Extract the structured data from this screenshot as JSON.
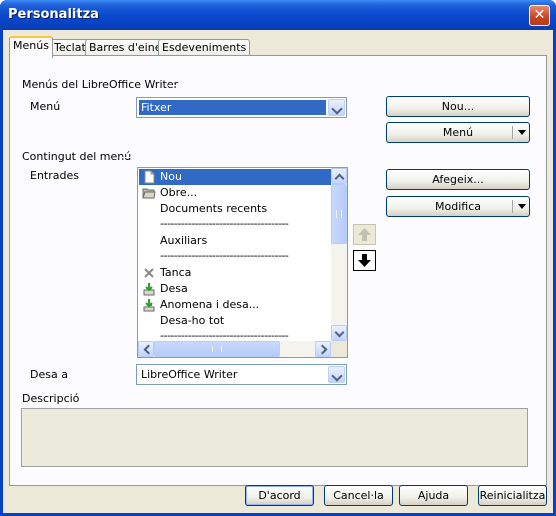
{
  "window": {
    "title": "Personalitza"
  },
  "tabs": [
    {
      "label": "Menús",
      "active": true
    },
    {
      "label": "Teclat",
      "active": false
    },
    {
      "label": "Barres d'eines",
      "active": false
    },
    {
      "label": "Esdeveniments",
      "active": false
    }
  ],
  "menus_section": {
    "heading": "Menús del LibreOffice Writer",
    "menu_label": "Menú",
    "menu_value": "Fitxer",
    "new_button": "Nou...",
    "menu_button": "Menú"
  },
  "content_section": {
    "heading": "Contingut del menú",
    "entries_label": "Entrades",
    "add_button": "Afegeix...",
    "modify_button": "Modifica",
    "entries": [
      {
        "label": "Nou",
        "icon": "new-document-icon",
        "selected": true
      },
      {
        "label": "Obre...",
        "icon": "open-folder-icon"
      },
      {
        "label": "Documents recents",
        "icon": ""
      },
      {
        "separator": true,
        "label": "-------------------------------------"
      },
      {
        "label": "Auxiliars",
        "icon": ""
      },
      {
        "separator": true,
        "label": "-------------------------------------"
      },
      {
        "label": "Tanca",
        "icon": "close-x-icon"
      },
      {
        "label": "Desa",
        "icon": "save-icon"
      },
      {
        "label": "Anomena i desa...",
        "icon": "save-as-icon"
      },
      {
        "label": "Desa-ho tot",
        "icon": ""
      },
      {
        "separator": true,
        "label": "-------------------------------------"
      }
    ]
  },
  "save_in": {
    "label": "Desa a",
    "value": "LibreOffice Writer"
  },
  "description": {
    "label": "Descripció",
    "text": ""
  },
  "footer": {
    "ok": "D'acord",
    "cancel": "Cancel·la",
    "help": "Ajuda",
    "reset": "Reinicialitza"
  },
  "colors": {
    "titlebar": "#0a4ad0",
    "selection": "#316ac5",
    "face": "#ece9d8"
  }
}
